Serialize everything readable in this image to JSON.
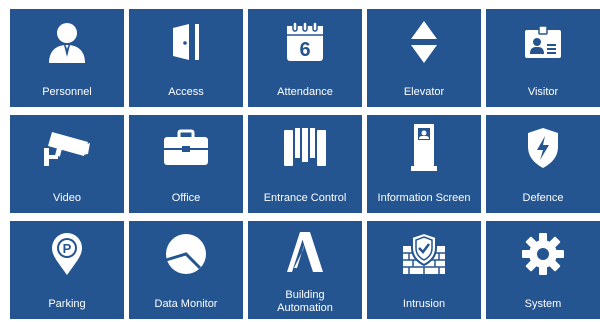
{
  "modules": [
    {
      "id": "personnel",
      "label": "Personnel",
      "icon": "person-icon"
    },
    {
      "id": "access",
      "label": "Access",
      "icon": "door-icon"
    },
    {
      "id": "attendance",
      "label": "Attendance",
      "icon": "calendar-icon",
      "icon_text": "6"
    },
    {
      "id": "elevator",
      "label": "Elevator",
      "icon": "up-down-arrows-icon"
    },
    {
      "id": "visitor",
      "label": "Visitor",
      "icon": "id-badge-icon"
    },
    {
      "id": "video",
      "label": "Video",
      "icon": "cctv-camera-icon"
    },
    {
      "id": "office",
      "label": "Office",
      "icon": "briefcase-icon"
    },
    {
      "id": "entrance-control",
      "label": "Entrance Control",
      "icon": "turnstile-icon"
    },
    {
      "id": "information-screen",
      "label": "Information Screen",
      "icon": "kiosk-icon"
    },
    {
      "id": "defence",
      "label": "Defence",
      "icon": "shield-bolt-icon"
    },
    {
      "id": "parking",
      "label": "Parking",
      "icon": "parking-pin-icon",
      "icon_text": "P"
    },
    {
      "id": "data-monitor",
      "label": "Data Monitor",
      "icon": "pie-chart-icon"
    },
    {
      "id": "building-automation",
      "label": "Building Automation",
      "icon": "a-logo-icon"
    },
    {
      "id": "intrusion",
      "label": "Intrusion",
      "icon": "firewall-shield-icon"
    },
    {
      "id": "system",
      "label": "System",
      "icon": "gear-icon"
    }
  ],
  "colors": {
    "tile": "#245591",
    "icon": "#ffffff"
  }
}
